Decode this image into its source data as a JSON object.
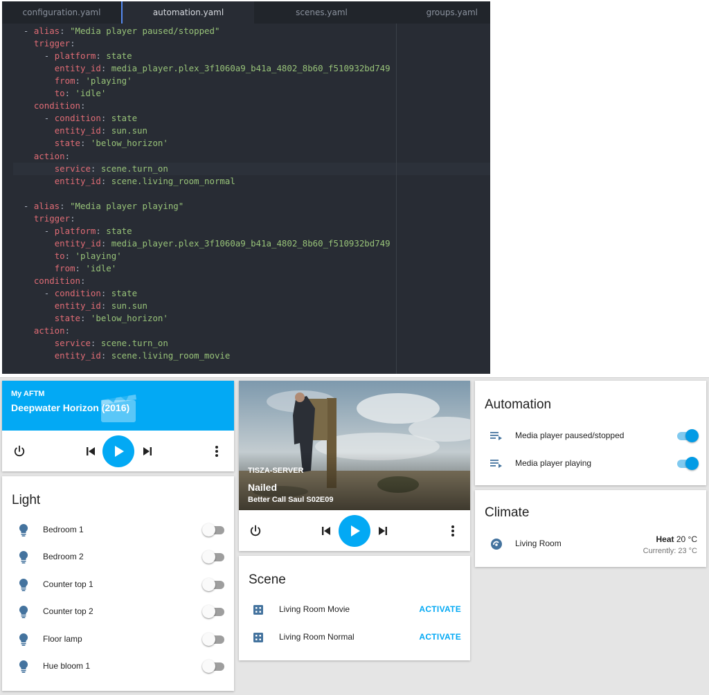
{
  "editor": {
    "tabs": [
      "configuration.yaml",
      "automation.yaml",
      "scenes.yaml",
      "groups.yaml"
    ],
    "active_tab": "automation.yaml",
    "lines": [
      [
        [
          "p",
          "  - "
        ],
        [
          "k",
          "alias"
        ],
        [
          "p",
          ": "
        ],
        [
          "s",
          "\"Media player paused/stopped\""
        ]
      ],
      [
        [
          "p",
          "    "
        ],
        [
          "k",
          "trigger"
        ],
        [
          "p",
          ":"
        ]
      ],
      [
        [
          "p",
          "      - "
        ],
        [
          "k",
          "platform"
        ],
        [
          "p",
          ": "
        ],
        [
          "s",
          "state"
        ]
      ],
      [
        [
          "p",
          "        "
        ],
        [
          "k",
          "entity_id"
        ],
        [
          "p",
          ": "
        ],
        [
          "s",
          "media_player.plex_3f1060a9_b41a_4802_8b60_f510932bd749"
        ]
      ],
      [
        [
          "p",
          "        "
        ],
        [
          "k",
          "from"
        ],
        [
          "p",
          ": "
        ],
        [
          "s",
          "'playing'"
        ]
      ],
      [
        [
          "p",
          "        "
        ],
        [
          "k",
          "to"
        ],
        [
          "p",
          ": "
        ],
        [
          "s",
          "'idle'"
        ]
      ],
      [
        [
          "p",
          "    "
        ],
        [
          "k",
          "condition"
        ],
        [
          "p",
          ":"
        ]
      ],
      [
        [
          "p",
          "      - "
        ],
        [
          "k",
          "condition"
        ],
        [
          "p",
          ": "
        ],
        [
          "s",
          "state"
        ]
      ],
      [
        [
          "p",
          "        "
        ],
        [
          "k",
          "entity_id"
        ],
        [
          "p",
          ": "
        ],
        [
          "s",
          "sun.sun"
        ]
      ],
      [
        [
          "p",
          "        "
        ],
        [
          "k",
          "state"
        ],
        [
          "p",
          ": "
        ],
        [
          "s",
          "'below_horizon'"
        ]
      ],
      [
        [
          "p",
          "    "
        ],
        [
          "k",
          "action"
        ],
        [
          "p",
          ":"
        ]
      ],
      [
        [
          "p",
          "        "
        ],
        [
          "k",
          "service"
        ],
        [
          "p",
          ": "
        ],
        [
          "s",
          "scene.turn_on"
        ]
      ],
      [
        [
          "p",
          "        "
        ],
        [
          "k",
          "entity_id"
        ],
        [
          "p",
          ": "
        ],
        [
          "s",
          "scene.living_room_normal"
        ]
      ],
      [
        [
          "p",
          ""
        ]
      ],
      [
        [
          "p",
          "  - "
        ],
        [
          "k",
          "alias"
        ],
        [
          "p",
          ": "
        ],
        [
          "s",
          "\"Media player playing\""
        ]
      ],
      [
        [
          "p",
          "    "
        ],
        [
          "k",
          "trigger"
        ],
        [
          "p",
          ":"
        ]
      ],
      [
        [
          "p",
          "      - "
        ],
        [
          "k",
          "platform"
        ],
        [
          "p",
          ": "
        ],
        [
          "s",
          "state"
        ]
      ],
      [
        [
          "p",
          "        "
        ],
        [
          "k",
          "entity_id"
        ],
        [
          "p",
          ": "
        ],
        [
          "s",
          "media_player.plex_3f1060a9_b41a_4802_8b60_f510932bd749"
        ]
      ],
      [
        [
          "p",
          "        "
        ],
        [
          "k",
          "to"
        ],
        [
          "p",
          ": "
        ],
        [
          "s",
          "'playing'"
        ]
      ],
      [
        [
          "p",
          "        "
        ],
        [
          "k",
          "from"
        ],
        [
          "p",
          ": "
        ],
        [
          "s",
          "'idle'"
        ]
      ],
      [
        [
          "p",
          "    "
        ],
        [
          "k",
          "condition"
        ],
        [
          "p",
          ":"
        ]
      ],
      [
        [
          "p",
          "      - "
        ],
        [
          "k",
          "condition"
        ],
        [
          "p",
          ": "
        ],
        [
          "s",
          "state"
        ]
      ],
      [
        [
          "p",
          "        "
        ],
        [
          "k",
          "entity_id"
        ],
        [
          "p",
          ": "
        ],
        [
          "s",
          "sun.sun"
        ]
      ],
      [
        [
          "p",
          "        "
        ],
        [
          "k",
          "state"
        ],
        [
          "p",
          ": "
        ],
        [
          "s",
          "'below_horizon'"
        ]
      ],
      [
        [
          "p",
          "    "
        ],
        [
          "k",
          "action"
        ],
        [
          "p",
          ":"
        ]
      ],
      [
        [
          "p",
          "        "
        ],
        [
          "k",
          "service"
        ],
        [
          "p",
          ": "
        ],
        [
          "s",
          "scene.turn_on"
        ]
      ],
      [
        [
          "p",
          "        "
        ],
        [
          "k",
          "entity_id"
        ],
        [
          "p",
          ": "
        ],
        [
          "s",
          "scene.living_room_movie"
        ]
      ]
    ],
    "highlighted_line": 11,
    "colors": {
      "background": "#282c34",
      "key": "#e06c75",
      "string": "#98c379",
      "tab_accent": "#568af2"
    }
  },
  "media1": {
    "source": "My AFTM",
    "title": "Deepwater Horizon (2016)",
    "icons": [
      "power-icon",
      "previous-icon",
      "play-icon",
      "next-icon",
      "more-icon",
      "film-icon"
    ]
  },
  "media2": {
    "source": "TISZA-SERVER",
    "title": "Nailed",
    "subtitle": "Better Call Saul S02E09",
    "icons": [
      "power-icon",
      "previous-icon",
      "play-icon",
      "next-icon",
      "more-icon"
    ]
  },
  "light": {
    "title": "Light",
    "items": [
      {
        "label": "Bedroom 1",
        "on": false
      },
      {
        "label": "Bedroom 2",
        "on": false
      },
      {
        "label": "Counter top 1",
        "on": false
      },
      {
        "label": "Counter top 2",
        "on": false
      },
      {
        "label": "Floor lamp",
        "on": false
      },
      {
        "label": "Hue bloom 1",
        "on": false
      }
    ],
    "icon": "bulb-icon"
  },
  "scene": {
    "title": "Scene",
    "items": [
      {
        "label": "Living Room Movie",
        "action": "ACTIVATE"
      },
      {
        "label": "Living Room Normal",
        "action": "ACTIVATE"
      }
    ],
    "icon": "scene-icon"
  },
  "automation": {
    "title": "Automation",
    "items": [
      {
        "label": "Media player paused/stopped",
        "on": true
      },
      {
        "label": "Media player playing",
        "on": true
      }
    ],
    "icon": "playlist-icon"
  },
  "climate": {
    "title": "Climate",
    "name": "Living Room",
    "mode": "Heat",
    "target": "20 °C",
    "current": "Currently: 23 °C",
    "icon": "thermostat-icon"
  },
  "accent": "#03a9f4"
}
